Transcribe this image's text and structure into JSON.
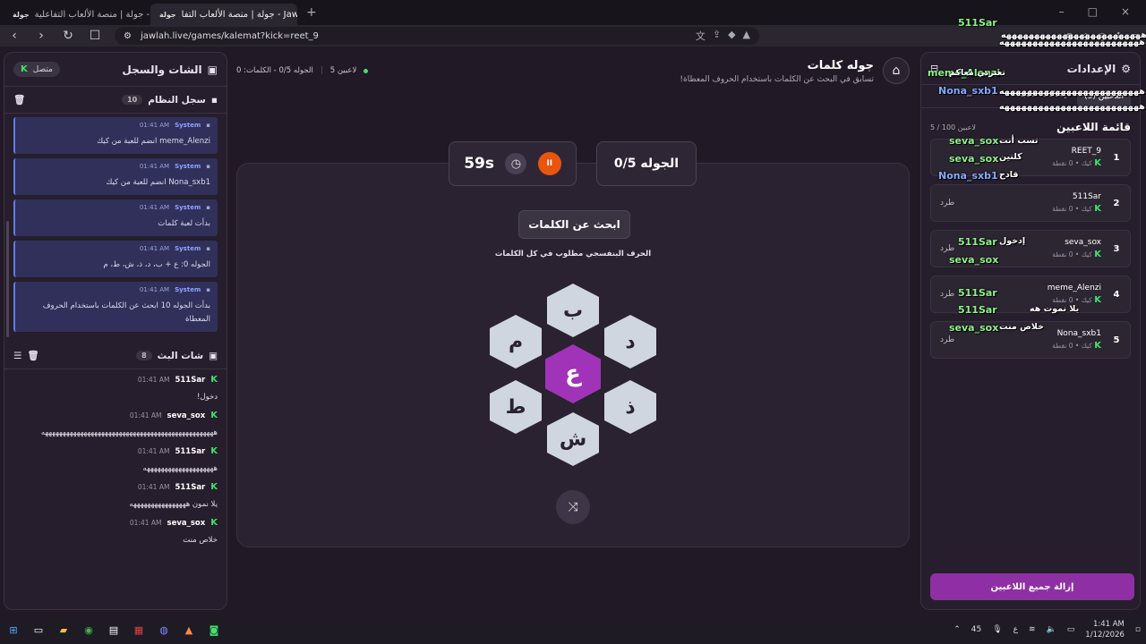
{
  "browser": {
    "tabs": [
      {
        "label": "جولة | منصة الألعاب التفاعلية - Jawlah",
        "favicon": "جولة",
        "active": false
      },
      {
        "label": "جولة | منصة الألعاب التفا - Jawlah",
        "favicon": "جولة",
        "active": true
      }
    ],
    "url": "jawlah.live/games/kalemat?kick=reet_9"
  },
  "chat_panel": {
    "title": "الشات والسجل",
    "status": "متصل",
    "system_log": {
      "title": "سجل النظام",
      "count": "10",
      "messages": [
        {
          "sender": "System",
          "time": "01:41 AM",
          "text": "meme_Alenzi انضم للعبة من كيك"
        },
        {
          "sender": "System",
          "time": "01:41 AM",
          "text": "Nona_sxb1 انضم للعبة من كيك"
        },
        {
          "sender": "System",
          "time": "01:41 AM",
          "text": "بدأت لعبة كلمات"
        },
        {
          "sender": "System",
          "time": "01:41 AM",
          "text": "الجوله 0: ع + ب، د، ذ، ش، ط، م"
        },
        {
          "sender": "System",
          "time": "01:41 AM",
          "text": "بدأت الجوله 10 ابحث عن الكلمات باستخدام الحروف المعطاة"
        }
      ]
    },
    "live_chat": {
      "title": "شات البث",
      "count": "8",
      "messages": [
        {
          "sender": "511Sar",
          "time": "01:41 AM",
          "text": "دخول!"
        },
        {
          "sender": "seva_sox",
          "time": "01:41 AM",
          "text": "هههههههههههههههههههههههههههههههههههههههههههههههههه"
        },
        {
          "sender": "511Sar",
          "time": "01:41 AM",
          "text": "ههههههههههههههههههههه"
        },
        {
          "sender": "511Sar",
          "time": "01:41 AM",
          "text": "يلا نمون ههههههههههههههههه"
        },
        {
          "sender": "seva_sox",
          "time": "01:41 AM",
          "text": "خلاص منت"
        }
      ]
    }
  },
  "game": {
    "title": "جوله كلمات",
    "subtitle": "تسابق في البحث عن الكلمات باستخدام الحروف المعطاة!",
    "players_count": "5 لاعبين",
    "round_words": "الجوله 0/5 - الكلمات: 0",
    "round_label": "الجوله 0/5",
    "timer": "59s",
    "pause_icon": "II",
    "board_title": "ابحث عن الكلمات",
    "board_hint": "الحرف البنفسجي مطلوب في كل الكلمات",
    "letters": {
      "center": "ع",
      "top": "ب",
      "top_right": "د",
      "bottom_right": "ذ",
      "bottom": "ش",
      "bottom_left": "ط",
      "top_left": "م"
    }
  },
  "players_panel": {
    "title": "الإعدادات",
    "tab_players": "اللاعبين (5)",
    "tab_settings": "إعدادات اللعبة",
    "list_title": "قائمة اللاعبين",
    "capacity": "5 / 100 لاعبين",
    "kick_label": "طرد",
    "players": [
      {
        "rank": "1",
        "name": "REET_9",
        "meta": "كيك • 0 نقطة"
      },
      {
        "rank": "2",
        "name": "511Sar",
        "meta": "كيك • 0 نقطة"
      },
      {
        "rank": "3",
        "name": "seva_sox",
        "meta": "كيك • 0 نقطة"
      },
      {
        "rank": "4",
        "name": "meme_Alenzi",
        "meta": "كيك • 0 نقطة"
      },
      {
        "rank": "5",
        "name": "Nona_sxb1",
        "meta": "كيك • 0 نقطة"
      }
    ],
    "remove_all": "إزالة جميع اللاعبين"
  },
  "overlay": [
    {
      "text": "511Sar",
      "c": "g"
    },
    {
      "text": "meme_Alenzi",
      "c": "g"
    },
    {
      "text": "Nona_sxb1",
      "c": "b"
    },
    {
      "text": "seva_sox",
      "c": "g"
    },
    {
      "text": "seva_sox",
      "c": "g"
    },
    {
      "text": "Nona_sxb1",
      "c": "b"
    },
    {
      "text": "511Sar",
      "c": "g"
    },
    {
      "text": "seva_sox",
      "c": "g"
    },
    {
      "text": "511Sar",
      "c": "g"
    },
    {
      "text": "511Sar",
      "c": "g"
    },
    {
      "text": "seva_sox",
      "c": "g"
    },
    {
      "text": "تعبرني معاكم",
      "c": "w"
    },
    {
      "text": "تسب أنت",
      "c": "w"
    },
    {
      "text": "كلتين",
      "c": "w"
    },
    {
      "text": "قادح",
      "c": "w"
    },
    {
      "text": "إدخول",
      "c": "w"
    },
    {
      "text": "يلا نموت هه",
      "c": "w"
    },
    {
      "text": "خلاص منت",
      "c": "w"
    },
    {
      "text": "هههههههههههههههههههههههههه",
      "c": "w"
    },
    {
      "text": "هههههههههههههههههههههههههه",
      "c": "w"
    },
    {
      "text": "هههههههههههههههههههههههههه",
      "c": "w"
    },
    {
      "text": "هههههههههههههههههههههههههه",
      "c": "w"
    }
  ],
  "taskbar": {
    "time": "1:41 AM",
    "date": "1/12/2026",
    "lang": "ع",
    "battery": "45"
  }
}
